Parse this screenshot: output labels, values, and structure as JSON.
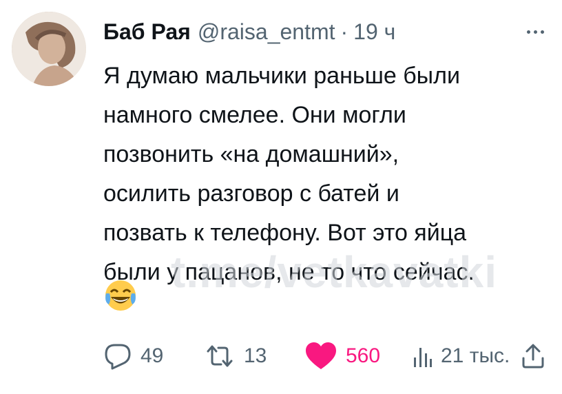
{
  "tweet": {
    "author_name": "Баб Рая",
    "handle": "@raisa_entmt",
    "separator": "·",
    "time": "19 ч",
    "text_lines": [
      "Я думаю мальчики раньше были",
      "намного смелее. Они могли",
      "позвонить «на домашний»,",
      "осилить разговор с батей и",
      "позвать к телефону. Вот это яйца",
      "были у пацанов, не то что сейчас."
    ],
    "emoji": "😂"
  },
  "watermark": "t.me/vetkavatki",
  "actions": {
    "replies": "49",
    "retweets": "13",
    "likes": "560",
    "views": "21 тыс."
  },
  "colors": {
    "text": "#0f1419",
    "secondary": "#536471",
    "like": "#f91880"
  },
  "icons": [
    "reply-icon",
    "retweet-icon",
    "heart-icon",
    "views-icon",
    "share-icon",
    "more-icon"
  ]
}
